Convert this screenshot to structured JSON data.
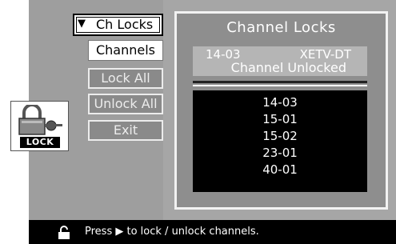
{
  "lock_icon": {
    "label": "LOCK",
    "icon": "padlock-key-icon"
  },
  "menu": {
    "title_arrow": "▼",
    "title": "Ch Locks",
    "items": [
      {
        "label": "Channels",
        "selected": true
      },
      {
        "label": "Lock All",
        "selected": false
      },
      {
        "label": "Unlock All",
        "selected": false
      },
      {
        "label": "Exit",
        "selected": false
      }
    ]
  },
  "panel": {
    "title": "Channel Locks",
    "current_channel": "14-03",
    "current_station": "XETV-DT",
    "current_status": "Channel Unlocked",
    "channels": [
      "14-03",
      "15-01",
      "15-02",
      "23-01",
      "40-01"
    ]
  },
  "status_bar": {
    "icon": "padlock-icon",
    "text_before": "Press",
    "arrow": "▶",
    "text_after": "to lock / unlock channels."
  },
  "colors": {
    "background": "#a6a6a6",
    "panel": "#8e8e8e",
    "list_background": "#000000",
    "text": "#ffffff"
  }
}
